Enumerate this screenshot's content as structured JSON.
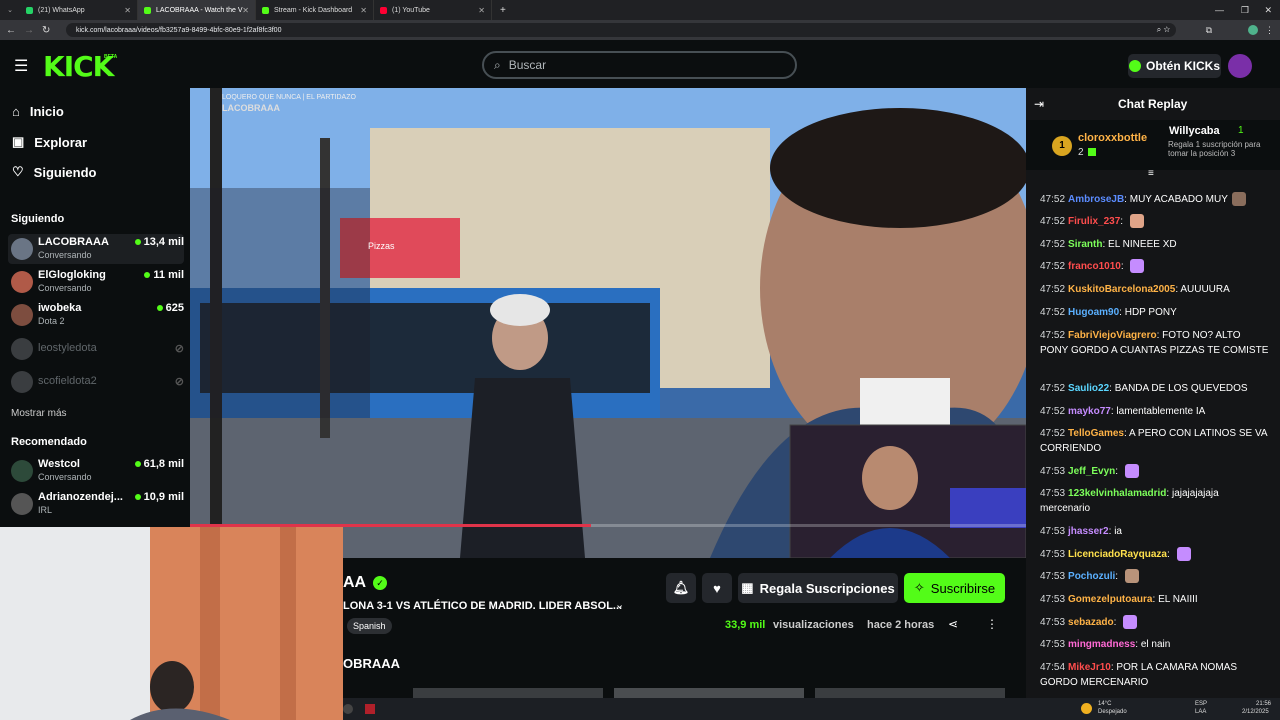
{
  "tabs": [
    {
      "label": "(21) WhatsApp",
      "color": "#25d366"
    },
    {
      "label": "LACOBRAAA - Watch the V",
      "color": "#53fc18"
    },
    {
      "label": "Stream - Kick Dashboard",
      "color": "#53fc18"
    },
    {
      "label": "(1) YouTube",
      "color": "#ff0033"
    }
  ],
  "url": "kick.com/lacobraaa/videos/fb3257a9-8499-4bfc-80e9-1f2af8fc3f00",
  "header": {
    "logo": "KICK",
    "logo_badge": "BETA",
    "search_placeholder": "Buscar",
    "kicks_button": "Obtén KICKs"
  },
  "nav": [
    {
      "label": "Inicio",
      "icon": "home-icon"
    },
    {
      "label": "Explorar",
      "icon": "compass-icon"
    },
    {
      "label": "Siguiendo",
      "icon": "heart-icon"
    }
  ],
  "following": {
    "title": "Siguiendo",
    "channels": [
      {
        "name": "LACOBRAAA",
        "sub": "Conversando",
        "viewers": "13,4 mil",
        "live": true
      },
      {
        "name": "ElGlogloking",
        "sub": "Conversando",
        "viewers": "11 mil",
        "live": true
      },
      {
        "name": "iwobeka",
        "sub": "Dota 2",
        "viewers": "625",
        "live": true
      },
      {
        "name": "leostyledota",
        "sub": "",
        "viewers": "",
        "live": false
      },
      {
        "name": "scofieldota2",
        "sub": "",
        "viewers": "",
        "live": false
      }
    ],
    "show_more": "Mostrar más"
  },
  "recommended": {
    "title": "Recomendado",
    "channels": [
      {
        "name": "Westcol",
        "sub": "Conversando",
        "viewers": "61,8 mil"
      },
      {
        "name": "Adrianozendej...",
        "sub": "IRL",
        "viewers": "10,9 mil"
      }
    ]
  },
  "video": {
    "overlay_title": "LOQUERO QUE NUNCA | EL PARTIDAZO",
    "overlay_name": "LACOBRAAA",
    "sign_text": "Pizzas",
    "progress": 0.48
  },
  "info": {
    "channel_name": "AA",
    "channel_name_full": "LACOBRAAA",
    "title": "LONA 3-1 VS ATLÉTICO DE MADRID. LIDER ABSOL...",
    "tag": "Spanish",
    "gift_button": "Regala Suscripciones",
    "subscribe_button": "Suscribirse",
    "views": "33,9 mil",
    "views_label": "visualizaciones",
    "time": "hace 2 horas",
    "section_title": "OBRAAA"
  },
  "chat": {
    "title": "Chat Replay",
    "pinned": {
      "rank": "1",
      "user": "cloroxxbottle",
      "count": "2",
      "gifter": "Willycaba",
      "gifter_count": "1",
      "gift_text": "Regala 1 suscripción para tomar la posición 3"
    },
    "messages": [
      {
        "time": "47:52",
        "user": "AmbroseJB",
        "color": "#5b8cff",
        "text": "MUY ACABADO MUY",
        "emote": "#8a6d5c"
      },
      {
        "time": "47:52",
        "user": "Firulix_237",
        "color": "#ff4d4d",
        "text": "",
        "emote": "#e0a488"
      },
      {
        "time": "47:52",
        "user": "Siranth",
        "color": "#7dff5b",
        "text": "EL NINEEE XD",
        "emote": ""
      },
      {
        "time": "47:52",
        "user": "franco1010",
        "color": "#ff4d4d",
        "text": "",
        "emote": "#c58cff"
      },
      {
        "time": "47:52",
        "user": "KuskitoBarcelona2005",
        "color": "#ffb347",
        "text": "AUUUURA",
        "emote": ""
      },
      {
        "time": "47:52",
        "user": "Hugoam90",
        "color": "#5bb0ff",
        "text": "HDP PONY",
        "emote": ""
      },
      {
        "time": "47:52",
        "user": "FabriViejoViagrero",
        "color": "#ffb347",
        "text": "FOTO NO? ALTO PONY GORDO A CUANTAS PIZZAS TE COMISTE",
        "emote": ""
      },
      {
        "time": "47:52",
        "user": "Saulio22",
        "color": "#5bd6ff",
        "text": "BANDA DE LOS QUEVEDOS",
        "emote": ""
      },
      {
        "time": "47:52",
        "user": "mayko77",
        "color": "#c58cff",
        "text": "lamentablemente IA",
        "emote": ""
      },
      {
        "time": "47:52",
        "user": "TelloGames",
        "color": "#ffb347",
        "text": "A PERO CON LATINOS SE VA CORRIENDO",
        "emote": ""
      },
      {
        "time": "47:53",
        "user": "Jeff_Evyn",
        "color": "#7dff5b",
        "text": "",
        "emote": "#c58cff"
      },
      {
        "time": "47:53",
        "user": "123kelvinhalamadrid",
        "color": "#7dff5b",
        "text": "jajajajajaja mercenario",
        "emote": ""
      },
      {
        "time": "47:53",
        "user": "jhasser2",
        "color": "#c58cff",
        "text": "ia",
        "emote": ""
      },
      {
        "time": "47:53",
        "user": "LicenciadoRayquaza",
        "color": "#ffe14d",
        "text": "",
        "emote": "#c58cff"
      },
      {
        "time": "47:53",
        "user": "Pochozuli",
        "color": "#5bb0ff",
        "text": "",
        "emote": "#b8937a"
      },
      {
        "time": "47:53",
        "user": "Gomezelputoaura",
        "color": "#ffb347",
        "text": "EL NAIIII",
        "emote": ""
      },
      {
        "time": "47:53",
        "user": "sebazado",
        "color": "#ffb347",
        "text": "",
        "emote": "#c58cff"
      },
      {
        "time": "47:53",
        "user": "mingmadness",
        "color": "#ff6ad5",
        "text": "el nain",
        "emote": ""
      },
      {
        "time": "47:54",
        "user": "MikeJr10",
        "color": "#ff4d4d",
        "text": "POR LA CAMARA NOMAS GORDO MERCENARIO",
        "emote": ""
      }
    ]
  },
  "taskbar": {
    "weather": "14°C",
    "weather_desc": "Despejado",
    "lang": "ESP",
    "lang2": "LAA",
    "time": "21:56",
    "date": "2/12/2025"
  }
}
